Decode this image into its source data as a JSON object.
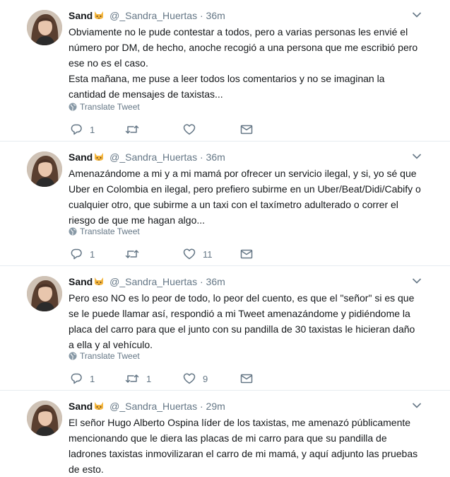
{
  "tweets": [
    {
      "display_name": "Sand",
      "emoji_icon": "cat-face-icon",
      "handle": "@_Sandra_Huertas",
      "separator": "·",
      "time": "36m",
      "paragraphs": [
        "Obviamente no le pude contestar a todos, pero a varias personas les envié el número por DM, de hecho, anoche recogió a una persona que me escribió pero ese no es el caso.",
        "Esta mañana, me puse a leer todos los comentarios y no se imaginan la cantidad de mensajes de taxistas..."
      ],
      "translate_label": "Translate Tweet",
      "reply_count": "1",
      "retweet_count": "",
      "like_count": ""
    },
    {
      "display_name": "Sand",
      "emoji_icon": "cat-face-icon",
      "handle": "@_Sandra_Huertas",
      "separator": "·",
      "time": "36m",
      "paragraphs": [
        "Amenazándome a mi y a mi mamá por ofrecer un servicio ilegal, y si, yo sé que Uber en Colombia en ilegal, pero prefiero subirme en un Uber/Beat/Didi/Cabify o cualquier otro, que subirme a un taxi con el taxímetro adulterado o correr el riesgo de que me hagan algo..."
      ],
      "translate_label": "Translate Tweet",
      "reply_count": "1",
      "retweet_count": "",
      "like_count": "11"
    },
    {
      "display_name": "Sand",
      "emoji_icon": "cat-face-icon",
      "handle": "@_Sandra_Huertas",
      "separator": "·",
      "time": "36m",
      "paragraphs": [
        "Pero eso NO es lo peor de todo, lo peor del cuento, es que el \"señor\" si es que se le puede llamar así, respondió a mi Tweet amenazándome y pidiéndome la placa del carro para que el junto con su pandilla de 30 taxistas le hicieran daño a ella y al vehículo."
      ],
      "translate_label": "Translate Tweet",
      "reply_count": "1",
      "retweet_count": "1",
      "like_count": "9"
    },
    {
      "display_name": "Sand",
      "emoji_icon": "cat-face-icon",
      "handle": "@_Sandra_Huertas",
      "separator": "·",
      "time": "29m",
      "paragraphs": [
        "El señor Hugo Alberto Ospina líder de los taxistas, me amenazó públicamente mencionando que le diera las placas de mi carro para que su pandilla de ladrones taxistas inmovilizaran el carro de mi mamá, y aquí adjunto las pruebas de esto."
      ],
      "translate_label": "",
      "reply_count": "",
      "retweet_count": "",
      "like_count": ""
    }
  ],
  "colors": {
    "text": "#14171a",
    "secondary": "#657786",
    "divider": "#e6ecf0"
  }
}
